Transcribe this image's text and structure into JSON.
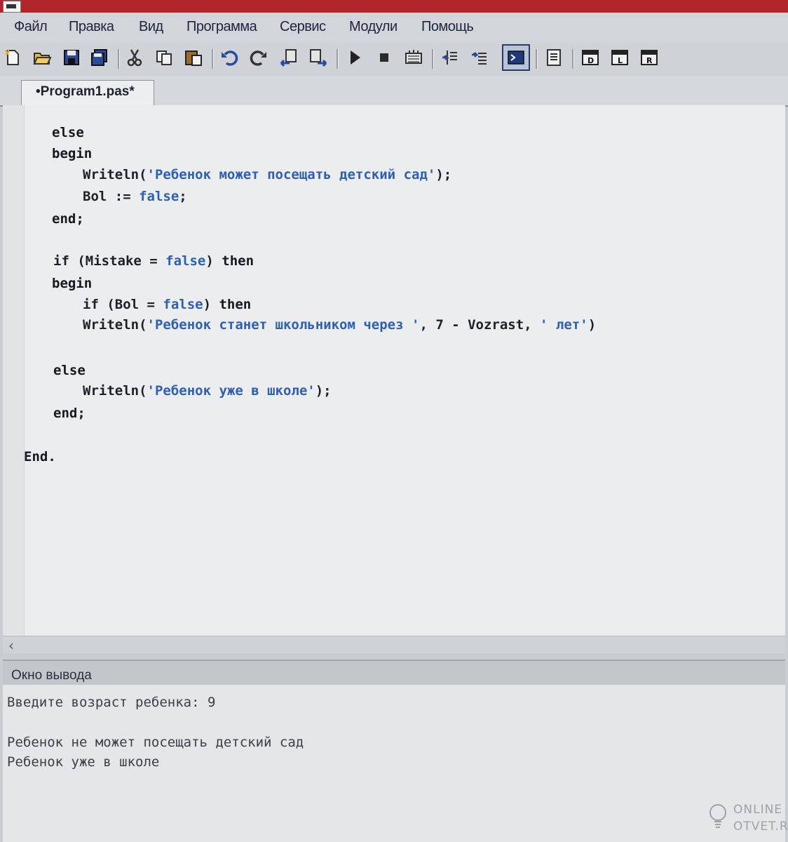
{
  "menu": {
    "file": "Файл",
    "edit": "Правка",
    "view": "Вид",
    "program": "Программа",
    "service": "Сервис",
    "modules": "Модули",
    "help": "Помощь"
  },
  "toolbar": {
    "icons": [
      "new-file-icon",
      "open-folder-icon",
      "save-icon",
      "save-all-icon",
      "cut-icon",
      "copy-icon",
      "paste-icon",
      "undo-icon",
      "redo-icon",
      "find-icon",
      "replace-icon",
      "run-icon",
      "stop-icon",
      "compile-icon",
      "step-into-icon",
      "step-over-icon",
      "output-window-icon",
      "format-icon",
      "insert-template-d-icon",
      "insert-template-l-icon",
      "insert-template-r-icon"
    ]
  },
  "tab": {
    "label": "•Program1.pas*"
  },
  "code": {
    "l1": "else",
    "l2": "begin",
    "l3_a": "Writeln(",
    "l3_str": "'Ребенок может посещать детский сад'",
    "l3_b": ");",
    "l4_a": "Bol := ",
    "l4_bool": "false",
    "l4_b": ";",
    "l5": "end;",
    "l6_a": "if (Mistake = ",
    "l6_bool": "false",
    "l6_b": ") ",
    "l6_kw": "then",
    "l7": "begin",
    "l8_a": "if (Bol = ",
    "l8_bool": "false",
    "l8_b": ") ",
    "l8_kw": "then",
    "l9_a": "Writeln(",
    "l9_str1": "'Ребенок станет школьником через '",
    "l9_b": ", 7 - Vozrast, ",
    "l9_str2": "' лет'",
    "l9_c": ")",
    "l10": "else",
    "l11_a": "Writeln(",
    "l11_str": "'Ребенок уже в школе'",
    "l11_b": ");",
    "l12": "end;",
    "l13": "End."
  },
  "output": {
    "title": "Окно вывода",
    "line1": "Введите возраст ребенка: 9",
    "line2": "Ребенок не может посещать детский сад",
    "line3": "Ребенок уже в школе"
  },
  "watermark": {
    "line1": "ONLINE",
    "line2": "OTVET.RU"
  },
  "colors": {
    "string": "#2e5fb3",
    "keyword": "#15181f",
    "editor_bg": "#ebedee",
    "output_bg": "#e4e6e8",
    "titlebar": "#b1252b"
  }
}
